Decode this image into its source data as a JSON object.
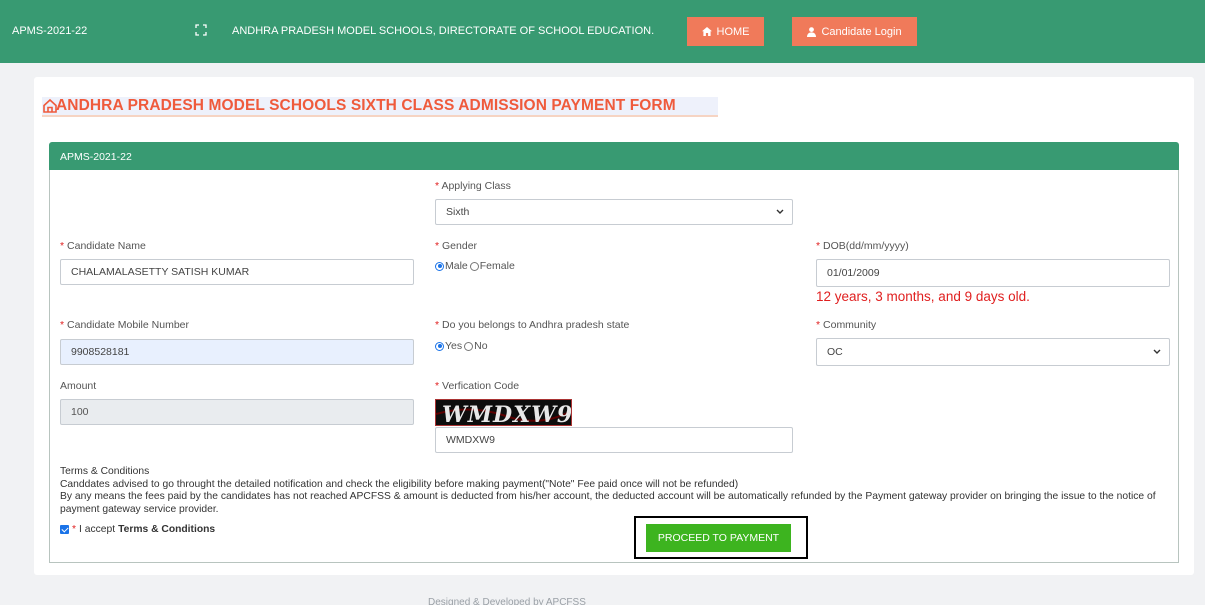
{
  "topbar": {
    "brand": "APMS-2021-22",
    "org_title": "ANDHRA PRADESH MODEL SCHOOLS, DIRECTORATE OF SCHOOL EDUCATION.",
    "home_label": "HOME",
    "login_label": "Candidate Login"
  },
  "page": {
    "title": "ANDHRA PRADESH MODEL SCHOOLS SIXTH CLASS ADMISSION PAYMENT FORM",
    "panel_title": "APMS-2021-22"
  },
  "form": {
    "required_mark": "*",
    "applying_class": {
      "label": "Applying Class",
      "value": "Sixth"
    },
    "candidate_name": {
      "label": "Candidate Name",
      "value": "CHALAMALASETTY SATISH KUMAR"
    },
    "gender": {
      "label": "Gender",
      "option_male": "Male",
      "option_female": "Female",
      "selected": "Male"
    },
    "dob": {
      "label": "DOB(dd/mm/yyyy)",
      "value": "01/01/2009",
      "age_text": "12 years, 3 months, and 9 days old."
    },
    "mobile": {
      "label": "Candidate Mobile Number",
      "value": "9908528181"
    },
    "ap_state": {
      "label": "Do you belongs to Andhra pradesh state",
      "option_yes": "Yes",
      "option_no": "No",
      "selected": "Yes"
    },
    "community": {
      "label": "Community",
      "value": "OC"
    },
    "amount": {
      "label": "Amount",
      "value": "100"
    },
    "verification": {
      "label": "Verfication Code",
      "captcha_text": "WMDXW9",
      "value": "WMDXW9"
    }
  },
  "terms": {
    "heading": "Terms & Conditions",
    "line1": "Canddates advised to go throught the detailed notification and check the eligibility before making payment(\"Note\" Fee paid once will not be refunded)",
    "line2": "By any means the fees paid by the candidates has not reached APCFSS & amount is deducted from his/her account, the deducted account will be automatically refunded by the Payment gateway provider on bringing the issue to the notice of payment gateway service provider.",
    "accept_prefix": "I accept",
    "accept_link": "Terms & Conditions"
  },
  "actions": {
    "proceed_label": "PROCEED TO PAYMENT"
  },
  "footer": {
    "text": "Designed & Developed by APCFSS"
  },
  "colors": {
    "header_green": "#389a72",
    "nav_orange": "#f07a5a",
    "title_orange": "#ef5a3c",
    "pay_green": "#3db41f",
    "required_red": "#e02020"
  }
}
